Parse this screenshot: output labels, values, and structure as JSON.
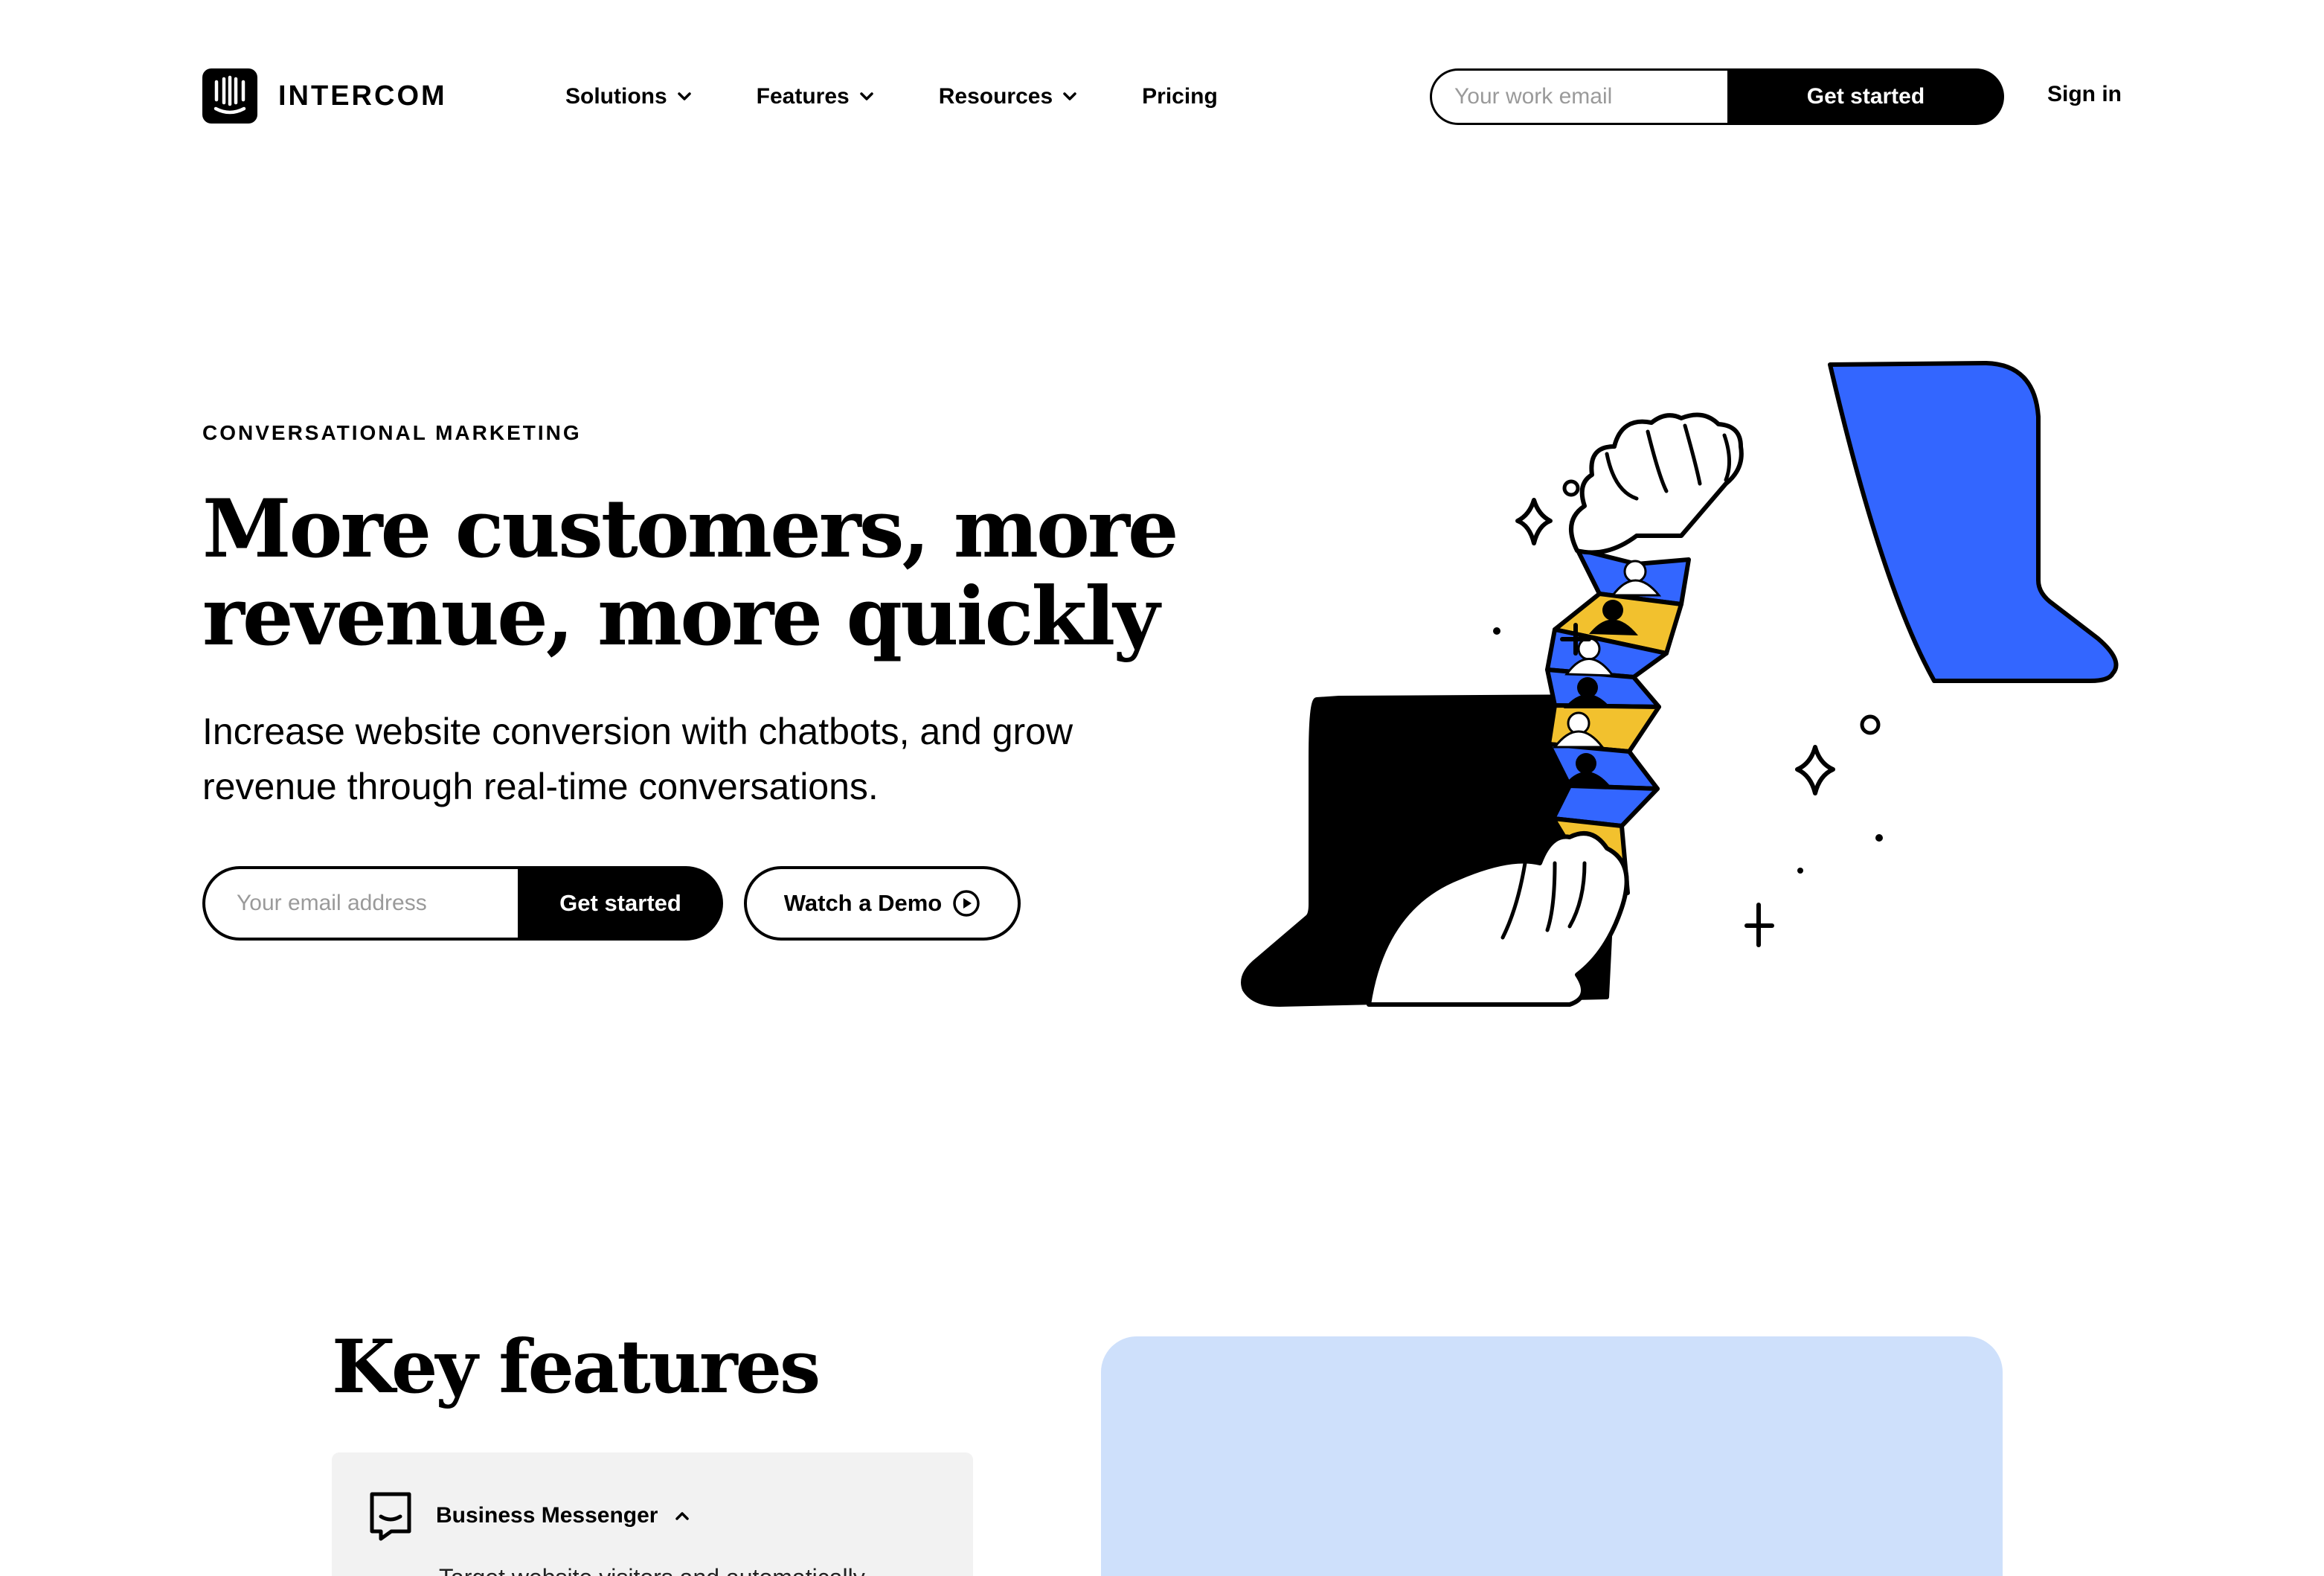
{
  "brand": {
    "name": "INTERCOM",
    "logo_icon": "intercom-logo-icon"
  },
  "nav": {
    "items": [
      {
        "label": "Solutions",
        "has_dropdown": true
      },
      {
        "label": "Features",
        "has_dropdown": true
      },
      {
        "label": "Resources",
        "has_dropdown": true
      },
      {
        "label": "Pricing",
        "has_dropdown": false
      }
    ],
    "email_placeholder": "Your work email",
    "cta_label": "Get started",
    "signin_label": "Sign in"
  },
  "hero": {
    "eyebrow": "CONVERSATIONAL MARKETING",
    "title_line1": "More customers, more",
    "title_line2": "revenue, more quickly",
    "subtitle_line1": "Increase website conversion with chatbots, and grow",
    "subtitle_line2": "revenue through real-time conversations.",
    "email_placeholder": "Your email address",
    "cta_label": "Get started",
    "demo_label": "Watch a Demo",
    "demo_icon": "play-circle-icon"
  },
  "key_features": {
    "title": "Key features",
    "items": [
      {
        "label": "Business Messenger",
        "icon": "messenger-icon",
        "expanded": true,
        "description": "Target website visitors and automatically"
      }
    ]
  },
  "colors": {
    "accent_blue": "#3366ff",
    "accent_yellow": "#f2c12e",
    "panel_blue": "#cee0fb",
    "card_gray": "#f2f2f2",
    "ink": "#000000"
  }
}
